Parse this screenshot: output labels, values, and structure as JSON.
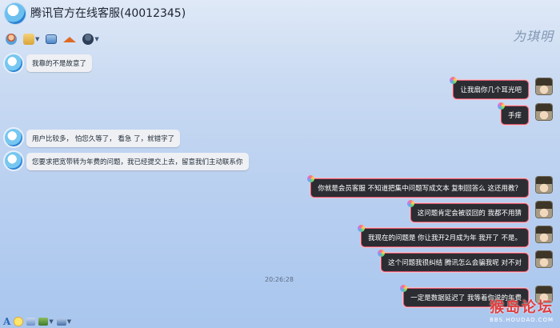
{
  "window": {
    "title": "腾讯官方在线客服(40012345)"
  },
  "toolbar": {
    "icons": [
      "add-user-icon",
      "folder-icon",
      "screen-icon",
      "home-icon",
      "user-icon"
    ]
  },
  "watermark_top": "为琪明",
  "messages": [
    {
      "side": "in",
      "text": "我靠的不是故意了"
    },
    {
      "side": "out",
      "text": "让我扇你几个耳光吧"
    },
    {
      "side": "out",
      "text": "手痒"
    },
    {
      "side": "in",
      "text": "用户比较多，  怕您久等了，  看急  了，就错字了"
    },
    {
      "side": "in",
      "text": "您要求把宽带转为年费的问题，我已经提交上去，留意我们主动联系你"
    },
    {
      "side": "out",
      "text": "你就是会员客服  不知道把集中问题写成文本      复制回答么  这还用教？"
    },
    {
      "side": "out",
      "text": "这问题肯定会被驳回的  我都不用猜"
    },
    {
      "side": "out",
      "text": "我现在的问题是  你让我开2月成为年   我开了  不是。"
    },
    {
      "side": "out",
      "text": "这个问题我很纠结   腾讯怎么会骗我呢   对不对"
    },
    {
      "side": "out",
      "text": "一定是数据延迟了  我等着你说的年费"
    }
  ],
  "timestamp": "20:26:28",
  "footer": {
    "font_icon": "A"
  },
  "watermark_bottom": {
    "main": "猴岛论坛",
    "sub": "BBS.HOUDAO.COM"
  }
}
